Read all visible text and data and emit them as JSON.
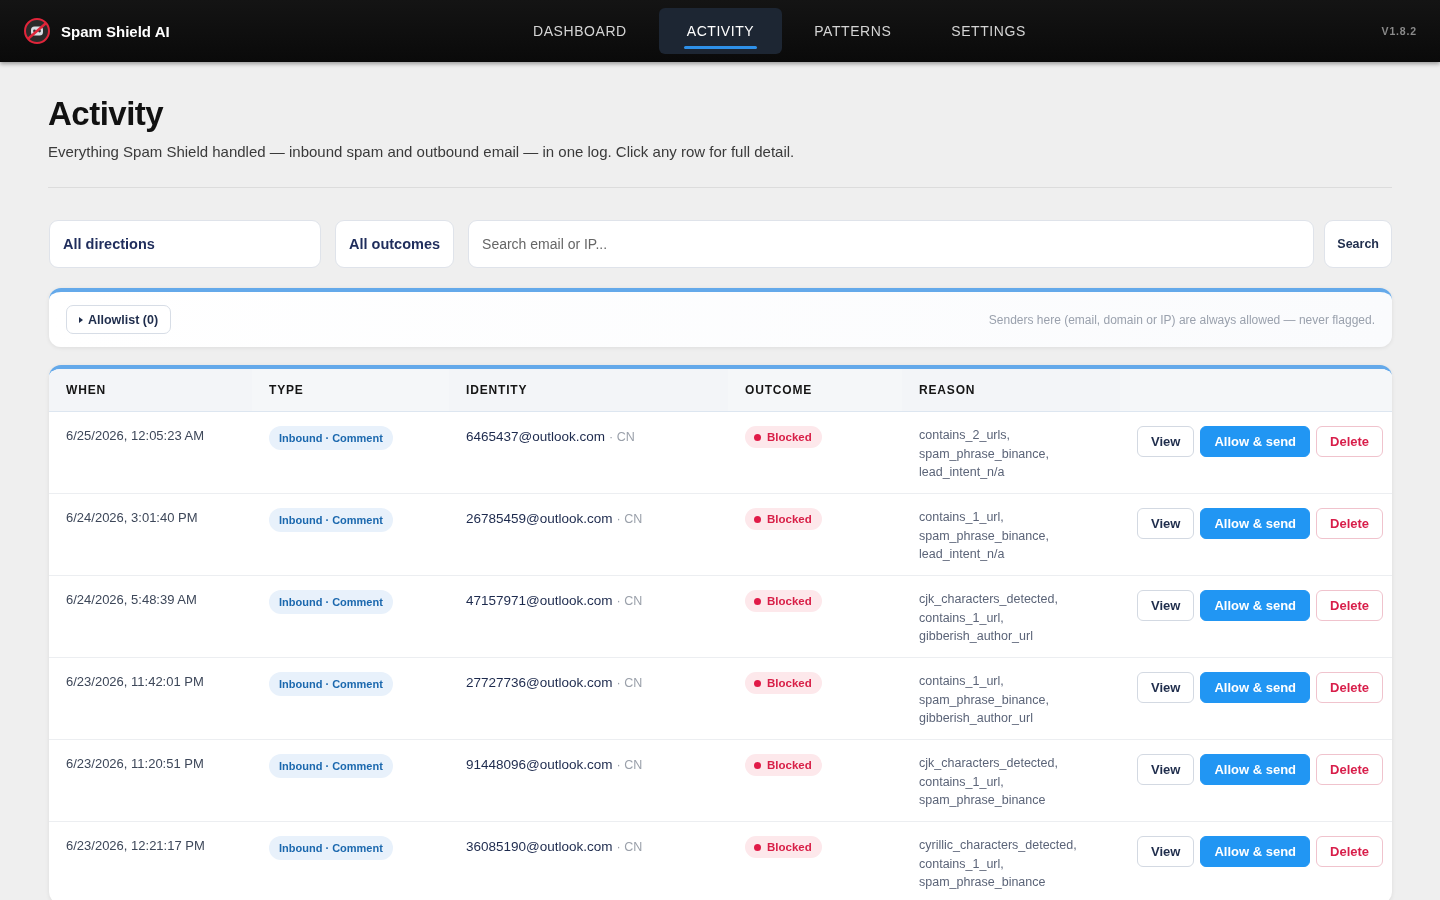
{
  "app": {
    "name": "Spam Shield AI",
    "version": "V1.8.2"
  },
  "nav": [
    {
      "label": "DASHBOARD",
      "selected": false
    },
    {
      "label": "ACTIVITY",
      "selected": true
    },
    {
      "label": "PATTERNS",
      "selected": false
    },
    {
      "label": "SETTINGS",
      "selected": false
    }
  ],
  "page": {
    "title": "Activity",
    "subtitle": "Everything Spam Shield handled — inbound spam and outbound email — in one log. Click any row for full detail."
  },
  "filters": {
    "direction": "All directions",
    "outcome": "All outcomes",
    "search": {
      "placeholder": "Search email or IP..."
    },
    "search_button": "Search"
  },
  "allowlist": {
    "label": "Allowlist (0)",
    "expanded": false,
    "note": "Senders here (email, domain or IP) are always allowed — never flagged."
  },
  "table": {
    "columns": [
      "WHEN",
      "TYPE",
      "IDENTITY",
      "OUTCOME",
      "REASON"
    ],
    "rows": [
      {
        "when": "6/25/2026, 12:05:23 AM",
        "type": "Inbound · Comment",
        "identity": "6465437@outlook.com",
        "origin": "· CN",
        "outcome": "Blocked",
        "reason": "contains_2_urls, spam_phrase_binance, lead_intent_n/a",
        "actions": [
          {
            "label": "View",
            "kind": "view"
          },
          {
            "label": "Allow & send",
            "kind": "allow"
          },
          {
            "label": "Delete",
            "kind": "delete"
          }
        ]
      },
      {
        "when": "6/24/2026, 3:01:40 PM",
        "type": "Inbound · Comment",
        "identity": "26785459@outlook.com",
        "origin": "· CN",
        "outcome": "Blocked",
        "reason": "contains_1_url, spam_phrase_binance, lead_intent_n/a",
        "actions": [
          {
            "label": "View",
            "kind": "view"
          },
          {
            "label": "Allow & send",
            "kind": "allow"
          },
          {
            "label": "Delete",
            "kind": "delete"
          }
        ]
      },
      {
        "when": "6/24/2026, 5:48:39 AM",
        "type": "Inbound · Comment",
        "identity": "47157971@outlook.com",
        "origin": "· CN",
        "outcome": "Blocked",
        "reason": "cjk_characters_detected, contains_1_url, gibberish_author_url",
        "actions": [
          {
            "label": "View",
            "kind": "view"
          },
          {
            "label": "Allow & send",
            "kind": "allow"
          },
          {
            "label": "Delete",
            "kind": "delete"
          }
        ]
      },
      {
        "when": "6/23/2026, 11:42:01 PM",
        "type": "Inbound · Comment",
        "identity": "27727736@outlook.com",
        "origin": "· CN",
        "outcome": "Blocked",
        "reason": "contains_1_url, spam_phrase_binance, gibberish_author_url",
        "actions": [
          {
            "label": "View",
            "kind": "view"
          },
          {
            "label": "Allow & send",
            "kind": "allow"
          },
          {
            "label": "Delete",
            "kind": "delete"
          }
        ]
      },
      {
        "when": "6/23/2026, 11:20:51 PM",
        "type": "Inbound · Comment",
        "identity": "91448096@outlook.com",
        "origin": "· CN",
        "outcome": "Blocked",
        "reason": "cjk_characters_detected, contains_1_url, spam_phrase_binance",
        "actions": [
          {
            "label": "View",
            "kind": "view"
          },
          {
            "label": "Allow & send",
            "kind": "allow"
          },
          {
            "label": "Delete",
            "kind": "delete"
          }
        ]
      },
      {
        "when": "6/23/2026, 12:21:17 PM",
        "type": "Inbound · Comment",
        "identity": "36085190@outlook.com",
        "origin": "· CN",
        "outcome": "Blocked",
        "reason": "cyrillic_characters_detected, contains_1_url, spam_phrase_binance",
        "actions": [
          {
            "label": "View",
            "kind": "view"
          },
          {
            "label": "Allow & send",
            "kind": "allow"
          },
          {
            "label": "Delete",
            "kind": "delete"
          }
        ]
      }
    ]
  }
}
